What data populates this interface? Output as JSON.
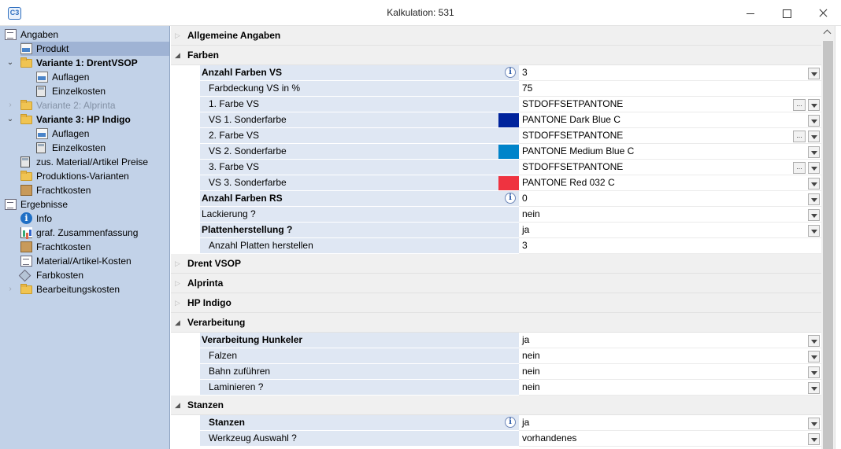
{
  "window": {
    "title": "Kalkulation: 531",
    "app_icon_text": "C3"
  },
  "tree": [
    {
      "label": "Angaben",
      "icon": "document-icon",
      "indent": 0,
      "expander": "",
      "bold": false,
      "selected": false,
      "disabled": false
    },
    {
      "label": "Produkt",
      "icon": "image-icon",
      "indent": 1,
      "expander": "",
      "bold": false,
      "selected": true,
      "disabled": false
    },
    {
      "label": "Variante 1: DrentVSOP",
      "icon": "folder-icon",
      "indent": 1,
      "expander": "open",
      "bold": true,
      "selected": false,
      "disabled": false
    },
    {
      "label": "Auflagen",
      "icon": "image-icon",
      "indent": 2,
      "expander": "",
      "bold": false,
      "selected": false,
      "disabled": false
    },
    {
      "label": "Einzelkosten",
      "icon": "calculator-icon",
      "indent": 2,
      "expander": "",
      "bold": false,
      "selected": false,
      "disabled": false
    },
    {
      "label": "Variante 2: Alprinta",
      "icon": "folder-icon",
      "indent": 1,
      "expander": "closed",
      "bold": false,
      "selected": false,
      "disabled": true
    },
    {
      "label": "Variante 3: HP Indigo",
      "icon": "folder-icon",
      "indent": 1,
      "expander": "open",
      "bold": true,
      "selected": false,
      "disabled": false
    },
    {
      "label": "Auflagen",
      "icon": "image-icon",
      "indent": 2,
      "expander": "",
      "bold": false,
      "selected": false,
      "disabled": false
    },
    {
      "label": "Einzelkosten",
      "icon": "calculator-icon",
      "indent": 2,
      "expander": "",
      "bold": false,
      "selected": false,
      "disabled": false
    },
    {
      "label": "zus. Material/Artikel Preise",
      "icon": "calculator-icon",
      "indent": 1,
      "expander": "",
      "bold": false,
      "selected": false,
      "disabled": false
    },
    {
      "label": "Produktions-Varianten",
      "icon": "folder-icon",
      "indent": 1,
      "expander": "",
      "bold": false,
      "selected": false,
      "disabled": false
    },
    {
      "label": "Frachtkosten",
      "icon": "box-icon",
      "indent": 1,
      "expander": "",
      "bold": false,
      "selected": false,
      "disabled": false
    },
    {
      "label": "Ergebnisse",
      "icon": "document-icon",
      "indent": 0,
      "expander": "",
      "bold": false,
      "selected": false,
      "disabled": false
    },
    {
      "label": "Info",
      "icon": "info-icon",
      "indent": 1,
      "expander": "",
      "bold": false,
      "selected": false,
      "disabled": false
    },
    {
      "label": "graf. Zusammenfassung",
      "icon": "chart-icon",
      "indent": 1,
      "expander": "",
      "bold": false,
      "selected": false,
      "disabled": false
    },
    {
      "label": "Frachtkosten",
      "icon": "box-icon",
      "indent": 1,
      "expander": "",
      "bold": false,
      "selected": false,
      "disabled": false
    },
    {
      "label": "Material/Artikel-Kosten",
      "icon": "document-icon",
      "indent": 1,
      "expander": "",
      "bold": false,
      "selected": false,
      "disabled": false
    },
    {
      "label": "Farbkosten",
      "icon": "paint-icon",
      "indent": 1,
      "expander": "",
      "bold": false,
      "selected": false,
      "disabled": false
    },
    {
      "label": "Bearbeitungskosten",
      "icon": "folder-icon",
      "indent": 1,
      "expander": "closed",
      "bold": false,
      "selected": false,
      "disabled": false
    }
  ],
  "grid": [
    {
      "kind": "group",
      "label": "Allgemeine Angaben",
      "open": false
    },
    {
      "kind": "gap"
    },
    {
      "kind": "group",
      "label": "Farben",
      "open": true
    },
    {
      "kind": "prop",
      "label": "Anzahl Farben VS",
      "value": "3",
      "bold": true,
      "sub": false,
      "info": true,
      "dropdown": true,
      "ellipsis": false,
      "swatch": null
    },
    {
      "kind": "prop",
      "label": "Farbdeckung VS in %",
      "value": "75",
      "bold": false,
      "sub": true,
      "info": false,
      "dropdown": false,
      "ellipsis": false,
      "swatch": null
    },
    {
      "kind": "prop",
      "label": "1. Farbe VS",
      "value": "STDOFFSETPANTONE",
      "bold": false,
      "sub": true,
      "info": false,
      "dropdown": true,
      "ellipsis": true,
      "swatch": null
    },
    {
      "kind": "prop",
      "label": "VS 1. Sonderfarbe",
      "value": "PANTONE Dark Blue C",
      "bold": false,
      "sub": true,
      "info": false,
      "dropdown": true,
      "ellipsis": false,
      "swatch": "#00239c"
    },
    {
      "kind": "prop",
      "label": "2. Farbe VS",
      "value": "STDOFFSETPANTONE",
      "bold": false,
      "sub": true,
      "info": false,
      "dropdown": true,
      "ellipsis": true,
      "swatch": null
    },
    {
      "kind": "prop",
      "label": "VS 2. Sonderfarbe",
      "value": "PANTONE Medium Blue C",
      "bold": false,
      "sub": true,
      "info": false,
      "dropdown": true,
      "ellipsis": false,
      "swatch": "#0084ca"
    },
    {
      "kind": "prop",
      "label": "3. Farbe VS",
      "value": "STDOFFSETPANTONE",
      "bold": false,
      "sub": true,
      "info": false,
      "dropdown": true,
      "ellipsis": true,
      "swatch": null
    },
    {
      "kind": "prop",
      "label": "VS 3. Sonderfarbe",
      "value": "PANTONE Red 032 C",
      "bold": false,
      "sub": true,
      "info": false,
      "dropdown": true,
      "ellipsis": false,
      "swatch": "#ef3340"
    },
    {
      "kind": "prop",
      "label": "Anzahl Farben RS",
      "value": "0",
      "bold": true,
      "sub": false,
      "info": true,
      "dropdown": true,
      "ellipsis": false,
      "swatch": null
    },
    {
      "kind": "prop",
      "label": "Lackierung ?",
      "value": "nein",
      "bold": false,
      "sub": false,
      "info": false,
      "dropdown": true,
      "ellipsis": false,
      "swatch": null
    },
    {
      "kind": "prop",
      "label": "Plattenherstellung ?",
      "value": "ja",
      "bold": true,
      "sub": false,
      "info": false,
      "dropdown": true,
      "ellipsis": false,
      "swatch": null
    },
    {
      "kind": "prop",
      "label": "Anzahl Platten herstellen",
      "value": "3",
      "bold": false,
      "sub": true,
      "info": false,
      "dropdown": false,
      "ellipsis": false,
      "swatch": null
    },
    {
      "kind": "group",
      "label": "Drent VSOP",
      "open": false
    },
    {
      "kind": "group",
      "label": "Alprinta",
      "open": false
    },
    {
      "kind": "group",
      "label": "HP Indigo",
      "open": false
    },
    {
      "kind": "group",
      "label": "Verarbeitung",
      "open": true
    },
    {
      "kind": "prop",
      "label": "Verarbeitung Hunkeler",
      "value": "ja",
      "bold": true,
      "sub": false,
      "info": false,
      "dropdown": true,
      "ellipsis": false,
      "swatch": null
    },
    {
      "kind": "prop",
      "label": "Falzen",
      "value": "nein",
      "bold": false,
      "sub": true,
      "info": false,
      "dropdown": true,
      "ellipsis": false,
      "swatch": null
    },
    {
      "kind": "prop",
      "label": "Bahn zuführen",
      "value": "nein",
      "bold": false,
      "sub": true,
      "info": false,
      "dropdown": true,
      "ellipsis": false,
      "swatch": null
    },
    {
      "kind": "prop",
      "label": "Laminieren ?",
      "value": "nein",
      "bold": false,
      "sub": true,
      "info": false,
      "dropdown": true,
      "ellipsis": false,
      "swatch": null
    },
    {
      "kind": "group",
      "label": "Stanzen",
      "open": true
    },
    {
      "kind": "prop",
      "label": "Stanzen",
      "value": "ja",
      "bold": true,
      "sub": true,
      "info": true,
      "dropdown": true,
      "ellipsis": false,
      "swatch": null
    },
    {
      "kind": "prop",
      "label": "Werkzeug Auswahl ?",
      "value": "vorhandenes",
      "bold": false,
      "sub": true,
      "info": false,
      "dropdown": true,
      "ellipsis": false,
      "swatch": null
    }
  ],
  "glyphs": {
    "info": "i",
    "ellipsis": "...",
    "expanded": "◢",
    "collapsed": "▷",
    "tree_open": "⌄",
    "tree_closed": "›"
  }
}
